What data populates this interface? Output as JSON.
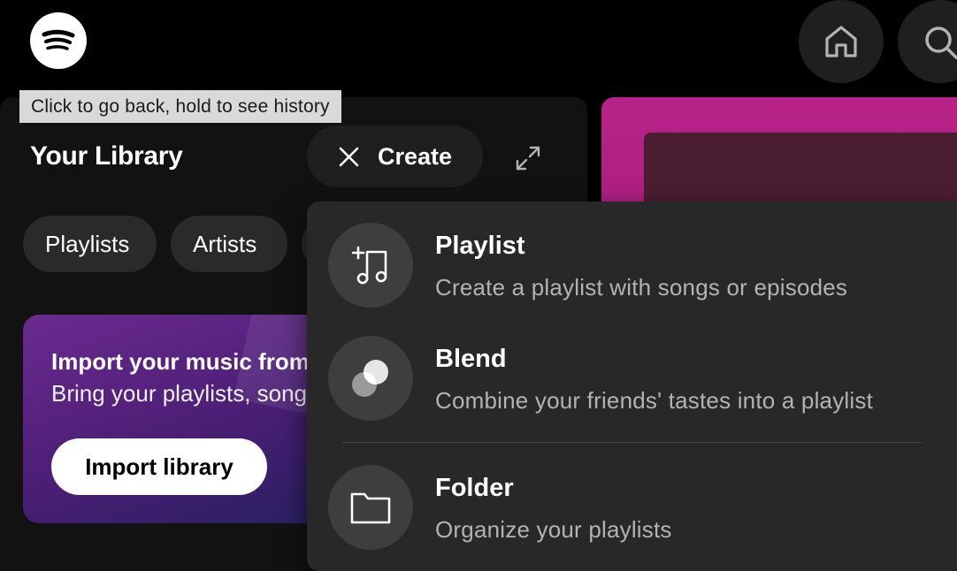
{
  "tooltip": {
    "text": "Click to go back, hold to see history"
  },
  "top_nav": {
    "logo_icon": "spotify-logo-icon",
    "home_icon": "home-icon",
    "search_icon": "search-icon"
  },
  "library": {
    "title": "Your Library",
    "create_label": "Create",
    "filters": [
      "Playlists",
      "Artists",
      ""
    ],
    "import_card": {
      "title": "Import your music from",
      "subtitle": "Bring your playlists, songs",
      "button_label": "Import library"
    }
  },
  "create_menu": {
    "items": [
      {
        "title": "Playlist",
        "description": "Create a playlist with songs or episodes",
        "icon": "add-music-note-icon"
      },
      {
        "title": "Blend",
        "description": "Combine your friends' tastes into a playlist",
        "icon": "blend-circles-icon"
      },
      {
        "title": "Folder",
        "description": "Organize your playlists",
        "icon": "folder-icon"
      }
    ]
  },
  "colors": {
    "background": "#000000",
    "panel": "#121212",
    "menu": "#282828",
    "accent_magenta": "#b8228a"
  }
}
